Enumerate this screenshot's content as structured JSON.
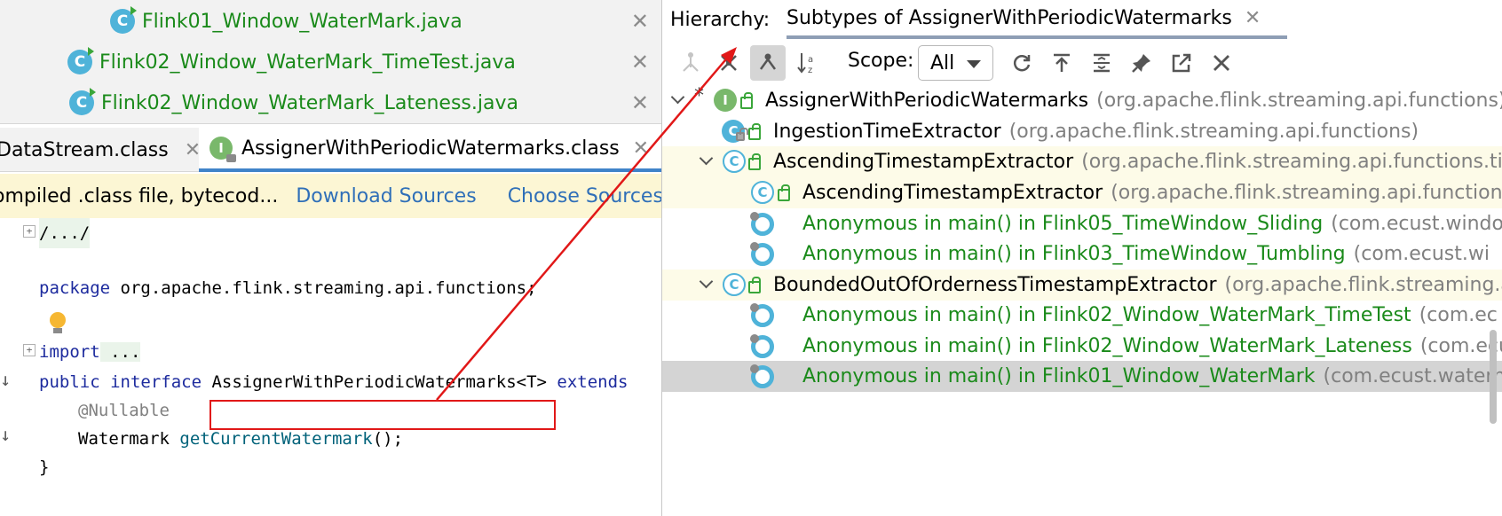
{
  "editor": {
    "recent_tabs": [
      {
        "name": "Flink01_Window_WaterMark.java"
      },
      {
        "name": "Flink02_Window_WaterMark_TimeTest.java"
      },
      {
        "name": "Flink02_Window_WaterMark_Lateness.java"
      }
    ],
    "tabs": [
      {
        "name": "DataStream.class"
      },
      {
        "name": "AssignerWithPeriodicWatermarks.class",
        "active": true
      }
    ],
    "banner": {
      "text": "ompiled .class file, bytecod...",
      "download_sources": "Download Sources",
      "choose_sources": "Choose Sources..."
    },
    "code": {
      "fold": "/.../",
      "package_kw": "package",
      "package_name": " org.apache.flink.streaming.api.functions;",
      "import_kw": "import",
      "import_rest": " ...",
      "public_kw": "public",
      "interface_kw": " interface",
      "interface_name": " AssignerWithPeriodicWatermarks<T>",
      "extends_kw": " extends",
      "annotation": "@Nullable",
      "method_type": "Watermark ",
      "method_name": "getCurrentWatermark",
      "method_tail": "();",
      "close_brace": "}"
    }
  },
  "hierarchy": {
    "label": "Hierarchy:",
    "tab_title": "Subtypes of AssignerWithPeriodicWatermarks",
    "scope_label": "Scope:",
    "scope_value": "All",
    "toolbar_icons": [
      "supertypes-icon",
      "subtypes-icon",
      "class-hierarchy-icon",
      "sort-alpha-icon",
      "refresh-icon",
      "export-icon",
      "expand-all-icon",
      "pin-icon",
      "open-external-icon",
      "close-icon"
    ],
    "tree": [
      {
        "name": "AssignerWithPeriodicWatermarks",
        "pkg": "(org.apache.flink.streaming.api.functions)",
        "kind": "interface"
      },
      {
        "name": "IngestionTimeExtractor",
        "pkg": "(org.apache.flink.streaming.api.functions)",
        "kind": "class"
      },
      {
        "name": "AscendingTimestampExtractor",
        "pkg": "(org.apache.flink.streaming.api.functions.tim",
        "kind": "abstract"
      },
      {
        "name": "AscendingTimestampExtractor",
        "pkg": "(org.apache.flink.streaming.api.functions)",
        "kind": "abstract"
      },
      {
        "name": "Anonymous in main() in Flink05_TimeWindow_Sliding",
        "pkg": "(com.ecust.windo",
        "kind": "anonymous"
      },
      {
        "name": "Anonymous in main() in Flink03_TimeWindow_Tumbling",
        "pkg": "(com.ecust.wi",
        "kind": "anonymous"
      },
      {
        "name": "BoundedOutOfOrdernessTimestampExtractor",
        "pkg": "(org.apache.flink.streaming.ap",
        "kind": "abstract"
      },
      {
        "name": "Anonymous in main() in Flink02_Window_WaterMark_TimeTest",
        "pkg": "(com.ec",
        "kind": "anonymous"
      },
      {
        "name": "Anonymous in main() in Flink02_Window_WaterMark_Lateness",
        "pkg": "(com.ecu",
        "kind": "anonymous"
      },
      {
        "name": "Anonymous in main() in Flink01_Window_WaterMark",
        "pkg": "(com.ecust.watern",
        "kind": "anonymous",
        "selected": true
      }
    ]
  },
  "colors": {
    "annotation_box": "#e11818",
    "selected_row": "#d4d4d4",
    "highlight_row": "#fdfbe8",
    "green_text": "#1a8a1a"
  }
}
